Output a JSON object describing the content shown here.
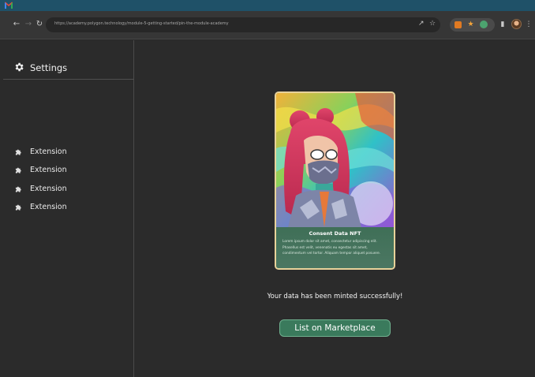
{
  "browser": {
    "url": "https://academy.polygon.technology/module-5-getting-started/pin-the-module-academy",
    "back_icon": "←",
    "forward_icon": "→",
    "reload_icon": "↻",
    "share_icon": "↗",
    "bookmark_icon": "☆",
    "puzzle_icon": "▮",
    "menu_icon": "⋮",
    "ext_star_icon": "★"
  },
  "sidebar": {
    "title": "Settings",
    "items": [
      {
        "label": "Extension"
      },
      {
        "label": "Extension"
      },
      {
        "label": "Extension"
      },
      {
        "label": "Extension"
      }
    ]
  },
  "card": {
    "name": "Consent Data NFT",
    "description": "Lorem ipsum dolor sit amet, consectetur adipiscing elit. Phasellus est velit, venenatis eu egestas sit amet, condimentum vel tortor. Aliquam tempor aliquet posuere."
  },
  "main": {
    "success_text": "Your data has been minted successfully!",
    "button_label": "List on Marketplace"
  },
  "colors": {
    "accent": "#3a7a5c",
    "os_strip": "#1f5168",
    "background": "#2b2b2b"
  }
}
